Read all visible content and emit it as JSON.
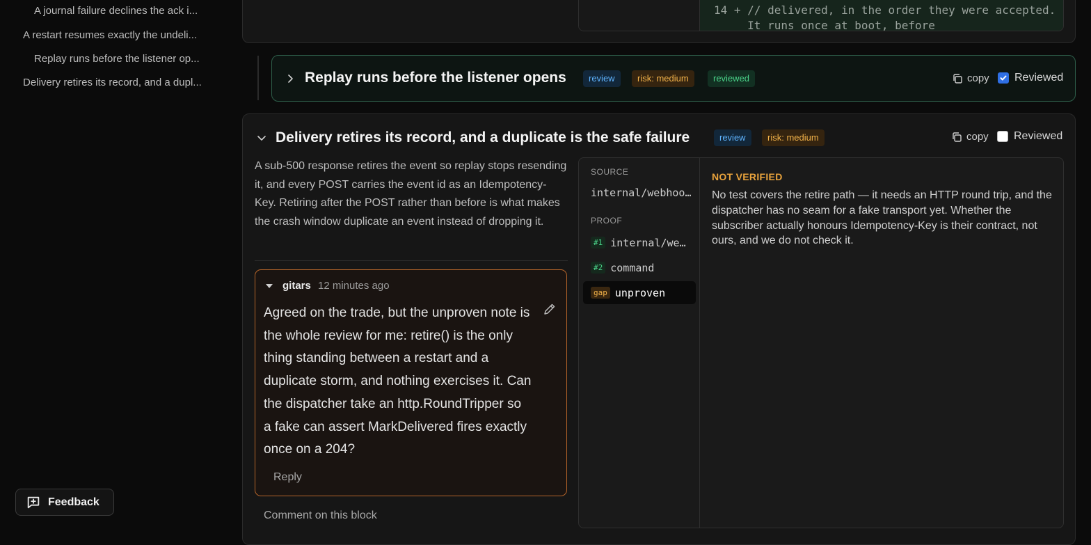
{
  "sidebar": {
    "items": [
      {
        "label": "A journal failure declines the ack i..."
      },
      {
        "label": "A restart resumes exactly the undeli..."
      },
      {
        "label": "Replay runs before the listener op..."
      },
      {
        "label": "Delivery retires its record, and a dupl..."
      }
    ],
    "feedback_label": "Feedback"
  },
  "diff": {
    "line1": "14 + // delivered, in the order they were accepted.",
    "line2": "     It runs once at boot, before"
  },
  "blocks": [
    {
      "title": "Replay runs before the listener opens",
      "badges": {
        "kind": "review",
        "risk": "risk: medium",
        "status": "reviewed"
      },
      "copy_label": "copy",
      "reviewed_label": "Reviewed",
      "reviewed": true
    },
    {
      "title": "Delivery retires its record, and a duplicate is the safe failure",
      "badges": {
        "kind": "review",
        "risk": "risk: medium"
      },
      "copy_label": "copy",
      "reviewed_label": "Reviewed",
      "reviewed": false,
      "summary": "A sub-500 response retires the event so replay stops resending it, and every POST carries the event id as an Idempotency-Key. Retiring after the POST rather than before is what makes the crash window duplicate an event instead of dropping it.",
      "comment": {
        "author": "gitars",
        "time": "12 minutes ago",
        "body": "Agreed on the trade, but the unproven note is the whole review for me: retire() is the only thing standing between a restart and a duplicate storm, and nothing exercises it. Can the dispatcher take an http.RoundTripper so a fake can assert MarkDelivered fires exactly once on a 204?",
        "reply_label": "Reply"
      },
      "comment_on_label": "Comment on this block",
      "evidence": {
        "source_label": "SOURCE",
        "source_value": "internal/webhooks",
        "proof_label": "PROOF",
        "proofs": [
          {
            "tag": "#1",
            "text": "internal/webhooks"
          },
          {
            "tag": "#2",
            "text": "command"
          },
          {
            "tag": "gap",
            "text": "unproven"
          }
        ],
        "status_title": "NOT VERIFIED",
        "status_body": "No test covers the retire path — it needs an HTTP round trip, and the dispatcher has no seam for a fake transport yet. Whether the subscriber actually honours Idempotency-Key is their contract, not ours, and we do not check it."
      }
    }
  ],
  "colors": {
    "accent_review": "#5fb4ff",
    "accent_risk": "#f3b34a",
    "accent_reviewed": "#4bd48a",
    "comment_border": "#b5652a",
    "not_verified": "#e9a33c"
  }
}
